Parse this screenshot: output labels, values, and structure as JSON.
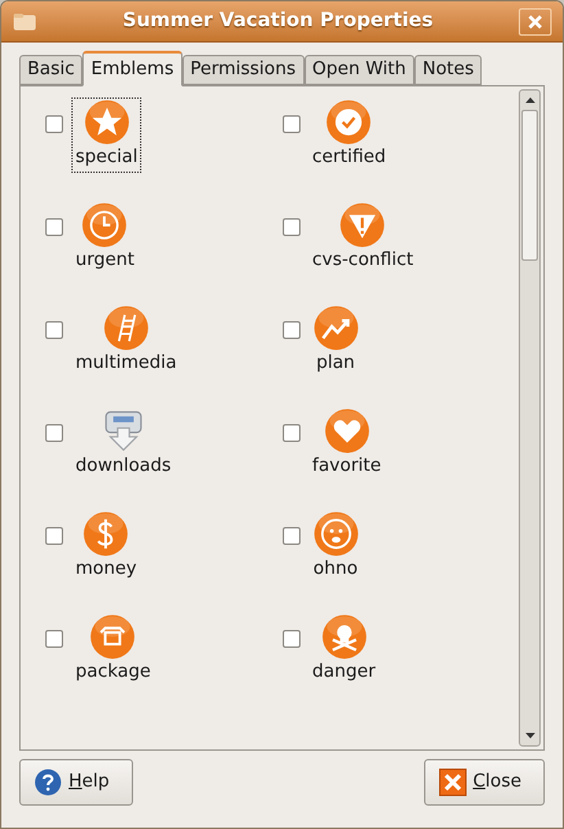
{
  "window": {
    "title": "Summer Vacation Properties"
  },
  "tabs": [
    {
      "label": "Basic",
      "selected": false
    },
    {
      "label": "Emblems",
      "selected": true
    },
    {
      "label": "Permissions",
      "selected": false
    },
    {
      "label": "Open With",
      "selected": false
    },
    {
      "label": "Notes",
      "selected": false
    }
  ],
  "emblems": [
    {
      "label": "special",
      "kind": "star",
      "checked": false,
      "focused": true
    },
    {
      "label": "certified",
      "kind": "seal",
      "checked": false,
      "focused": false
    },
    {
      "label": "urgent",
      "kind": "clock",
      "checked": false,
      "focused": false
    },
    {
      "label": "cvs-conflict",
      "kind": "warning",
      "checked": false,
      "focused": false
    },
    {
      "label": "multimedia",
      "kind": "film",
      "checked": false,
      "focused": false
    },
    {
      "label": "plan",
      "kind": "chart",
      "checked": false,
      "focused": false
    },
    {
      "label": "downloads",
      "kind": "download",
      "checked": false,
      "focused": false
    },
    {
      "label": "favorite",
      "kind": "heart",
      "checked": false,
      "focused": false
    },
    {
      "label": "money",
      "kind": "dollar",
      "checked": false,
      "focused": false
    },
    {
      "label": "ohno",
      "kind": "face",
      "checked": false,
      "focused": false
    },
    {
      "label": "package",
      "kind": "box",
      "checked": false,
      "focused": false
    },
    {
      "label": "danger",
      "kind": "skull",
      "checked": false,
      "focused": false
    }
  ],
  "buttons": [
    {
      "label": "Help",
      "kind": "help"
    },
    {
      "label": "Close",
      "kind": "close"
    }
  ]
}
